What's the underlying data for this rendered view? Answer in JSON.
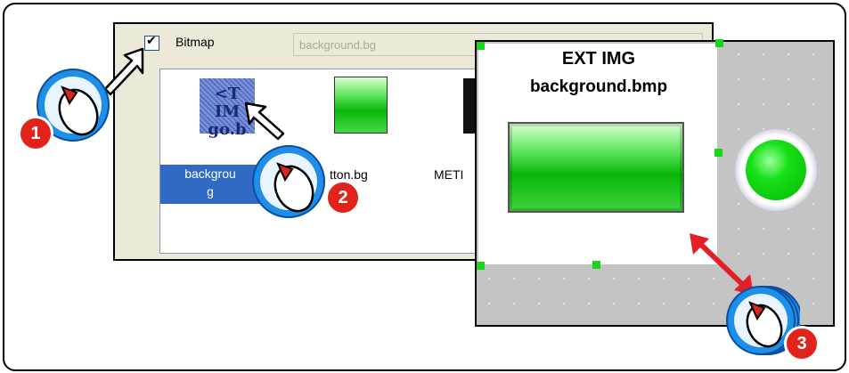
{
  "dialog": {
    "bitmap_checkbox_label": "Bitmap",
    "file_field_value": "background.bg",
    "files": [
      {
        "name_line1": "backgrou",
        "name_line2": "g",
        "thumb_text_line1": "<T IM",
        "thumb_text_line2": "go.b",
        "selected": true
      },
      {
        "name": "tton.bg"
      },
      {
        "name": "METI"
      }
    ]
  },
  "preview": {
    "title": "EXT IMG",
    "filename": "background.bmp"
  },
  "steps": {
    "step1": "1",
    "step2": "2",
    "step3": "3"
  },
  "colors": {
    "accent_blue": "#1e8ee6",
    "badge_red": "#e0241b",
    "button_green": "#0bb70b",
    "arrow_red": "#e41f26"
  }
}
